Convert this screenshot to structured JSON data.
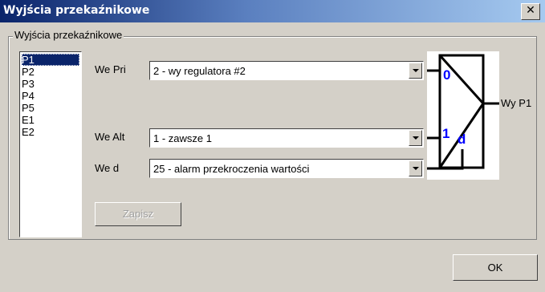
{
  "window": {
    "title": "Wyjścia przekaźnikowe",
    "close_glyph": "✕"
  },
  "group": {
    "legend": "Wyjścia przekaźnikowe"
  },
  "outputs_list": {
    "items": [
      "P1",
      "P2",
      "P3",
      "P4",
      "P5",
      "E1",
      "E2"
    ],
    "selected": "P1"
  },
  "inputs": {
    "pri": {
      "label": "We Pri",
      "value": "2 - wy regulatora #2"
    },
    "alt": {
      "label": "We Alt",
      "value": "1 - zawsze 1"
    },
    "d": {
      "label": "We d",
      "value": "25 - alarm przekroczenia wartości"
    }
  },
  "diagram": {
    "label_0": "0",
    "label_1": "1",
    "label_d": "d",
    "output_label": "Wy P1",
    "pin_color": "#0000ff"
  },
  "buttons": {
    "save": "Zapisz",
    "ok": "OK"
  },
  "colors": {
    "titlebar_start": "#0a246a",
    "titlebar_end": "#a6caf0",
    "face": "#d4d0c8",
    "selection": "#0a246a"
  }
}
